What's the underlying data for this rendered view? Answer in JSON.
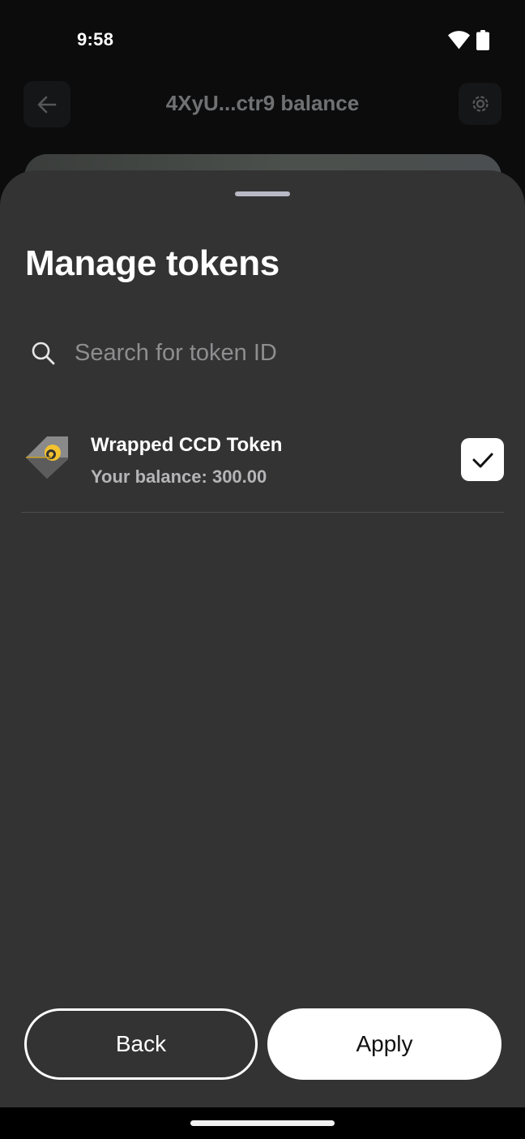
{
  "status_bar": {
    "time": "9:58",
    "icons": [
      "wifi-icon",
      "battery-icon"
    ]
  },
  "header": {
    "title": "4XyU...ctr9 balance",
    "back_icon": "arrow-left-icon",
    "settings_icon": "gear-icon"
  },
  "sheet": {
    "title": "Manage tokens",
    "search": {
      "placeholder": "Search for token ID",
      "value": "",
      "icon": "search-icon"
    },
    "tokens": [
      {
        "name": "Wrapped CCD Token",
        "balance": "Your balance: 300.00",
        "checked": true
      }
    ],
    "buttons": {
      "back": "Back",
      "apply": "Apply"
    }
  },
  "colors": {
    "sheet_bg": "#333333",
    "screen_bg": "#0c0c0d",
    "text_primary": "#ffffff",
    "text_secondary": "#b5b5b8",
    "placeholder": "#8e8e90",
    "token_logo_accent": "#f2c12e"
  }
}
